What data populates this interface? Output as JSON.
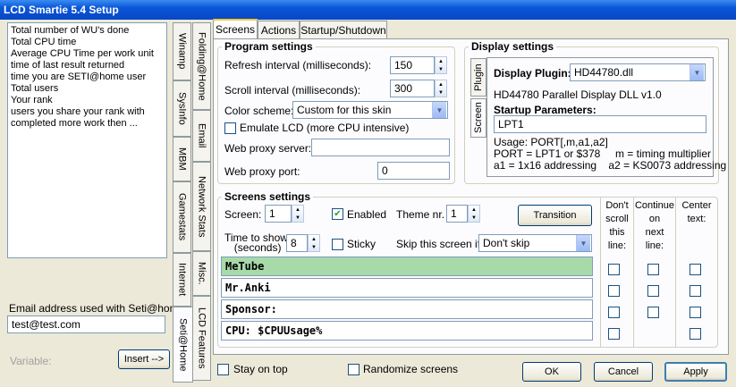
{
  "window": {
    "title": "LCD Smartie 5.4 Setup"
  },
  "left": {
    "items": [
      "Total number of WU's done",
      "Total CPU time",
      "Average CPU Time per work unit",
      "time of last result returned",
      "time you are SETI@home user",
      "Total users",
      "Your rank",
      "users you share your rank with",
      "completed more work then ..."
    ],
    "email_label": "Email address used with Seti@home",
    "email_value": "test@test.com",
    "variable_label": "Variable:",
    "insert_button": "Insert -->"
  },
  "vtabs": {
    "col1": [
      "Winamp",
      "SysInfo",
      "MBM",
      "Gamestats",
      "Internet",
      "Seti@Home"
    ],
    "col2": [
      "Folding@Home",
      "Email",
      "Network Stats",
      "Misc.",
      "LCD Features"
    ]
  },
  "tabs": [
    "Screens",
    "Actions",
    "Startup/Shutdown"
  ],
  "program": {
    "title": "Program settings",
    "refresh_label": "Refresh interval (milliseconds):",
    "refresh_value": "150",
    "scroll_label": "Scroll interval (milliseconds):",
    "scroll_value": "300",
    "color_label": "Color scheme:",
    "color_value": "Custom for this skin",
    "emulate_label": "Emulate LCD  (more CPU intensive)",
    "proxy_server_label": "Web proxy server:",
    "proxy_server_value": "",
    "proxy_port_label": "Web proxy port:",
    "proxy_port_value": "0"
  },
  "display": {
    "title": "Display settings",
    "side_tabs": [
      "Plugin",
      "Screen"
    ],
    "plugin_label": "Display Plugin:",
    "plugin_value": "HD44780.dll",
    "plugin_desc": "HD44780 Parallel Display DLL v1.0",
    "startup_label": "Startup Parameters:",
    "startup_value": "LPT1",
    "usage_1": "Usage: PORT[,m,a1,a2]",
    "usage_2": "PORT = LPT1 or $378     m = timing multiplier",
    "usage_3": "a1 = 1x16 addressing    a2 = KS0073 addressing"
  },
  "screens": {
    "title": "Screens settings",
    "screen_label": "Screen:",
    "screen_value": "1",
    "enabled_label": "Enabled",
    "theme_label": "Theme nr.",
    "theme_value": "1",
    "transition_button": "Transition",
    "time_label_1": "Time to show:",
    "time_label_2": "(seconds)",
    "time_value": "8",
    "sticky_label": "Sticky",
    "skip_label": "Skip this screen if:",
    "skip_value": "Don't skip",
    "col_noscroll": "Don't\nscroll\nthis\nline:",
    "col_continue": "Continue\non\nnext\nline:",
    "col_center": "Center\ntext:",
    "lines": [
      "MeTube",
      "Mr.Anki",
      "Sponsor:",
      "CPU: $CPUUsage%"
    ]
  },
  "bottom": {
    "stay_on_top": "Stay on top",
    "randomize": "Randomize screens",
    "ok": "OK",
    "cancel": "Cancel",
    "apply": "Apply"
  }
}
